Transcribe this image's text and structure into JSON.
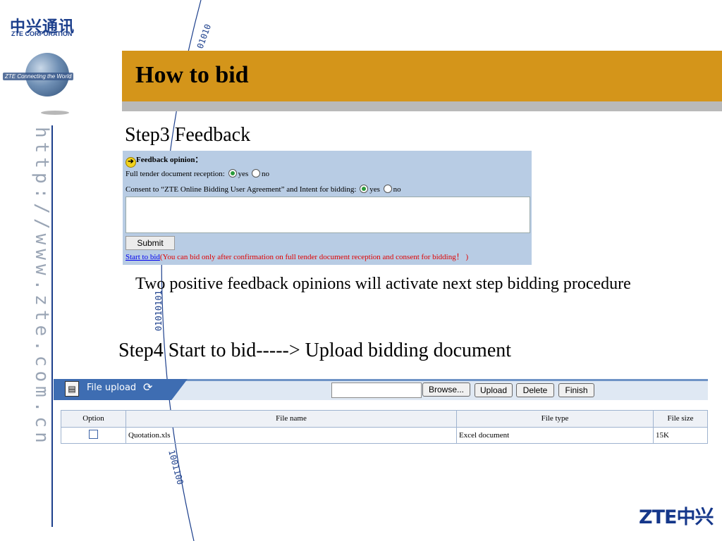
{
  "logo": {
    "cn": "中兴通讯",
    "en": "ZTE CORPORATION",
    "slogan": "ZTE Connecting the World"
  },
  "side_url": "http://www.zte.com.cn",
  "title": "How to bid",
  "step3": "Step3  Feedback",
  "feedback": {
    "heading": "Feedback opinion：",
    "q1_label": "Full tender document reception:",
    "q2_label": "Consent to “ZTE Online Bidding User Agreement” and Intent for bidding:",
    "yes": "yes",
    "no": "no",
    "q1_selected": "yes",
    "q2_selected": "yes",
    "submit": "Submit",
    "start_link": "Start to bid",
    "warning": "(You can bid only after confirmation on full tender document reception and consent for bidding！ )"
  },
  "note": "Two positive feedback opinions will activate next step bidding procedure",
  "step4": "Step4   Start to bid-----> Upload bidding document",
  "upload": {
    "tab_label": "File upload",
    "browse": "Browse...",
    "upload_btn": "Upload",
    "delete_btn": "Delete",
    "finish_btn": "Finish",
    "columns": [
      "Option",
      "File name",
      "File type",
      "File size"
    ],
    "rows": [
      {
        "file_name": "Quotation.xls",
        "file_type": "Excel document",
        "file_size": "15K"
      }
    ]
  },
  "arc_digits_top": "01010",
  "arc_digits_mid": "01010101",
  "arc_digits_bottom": "1001100",
  "brand_logo": "ZTE中兴",
  "colors": {
    "title_bar": "#d4951a",
    "panel": "#b8cce4",
    "tab": "#3e6db2",
    "brand": "#1c3f8c"
  }
}
